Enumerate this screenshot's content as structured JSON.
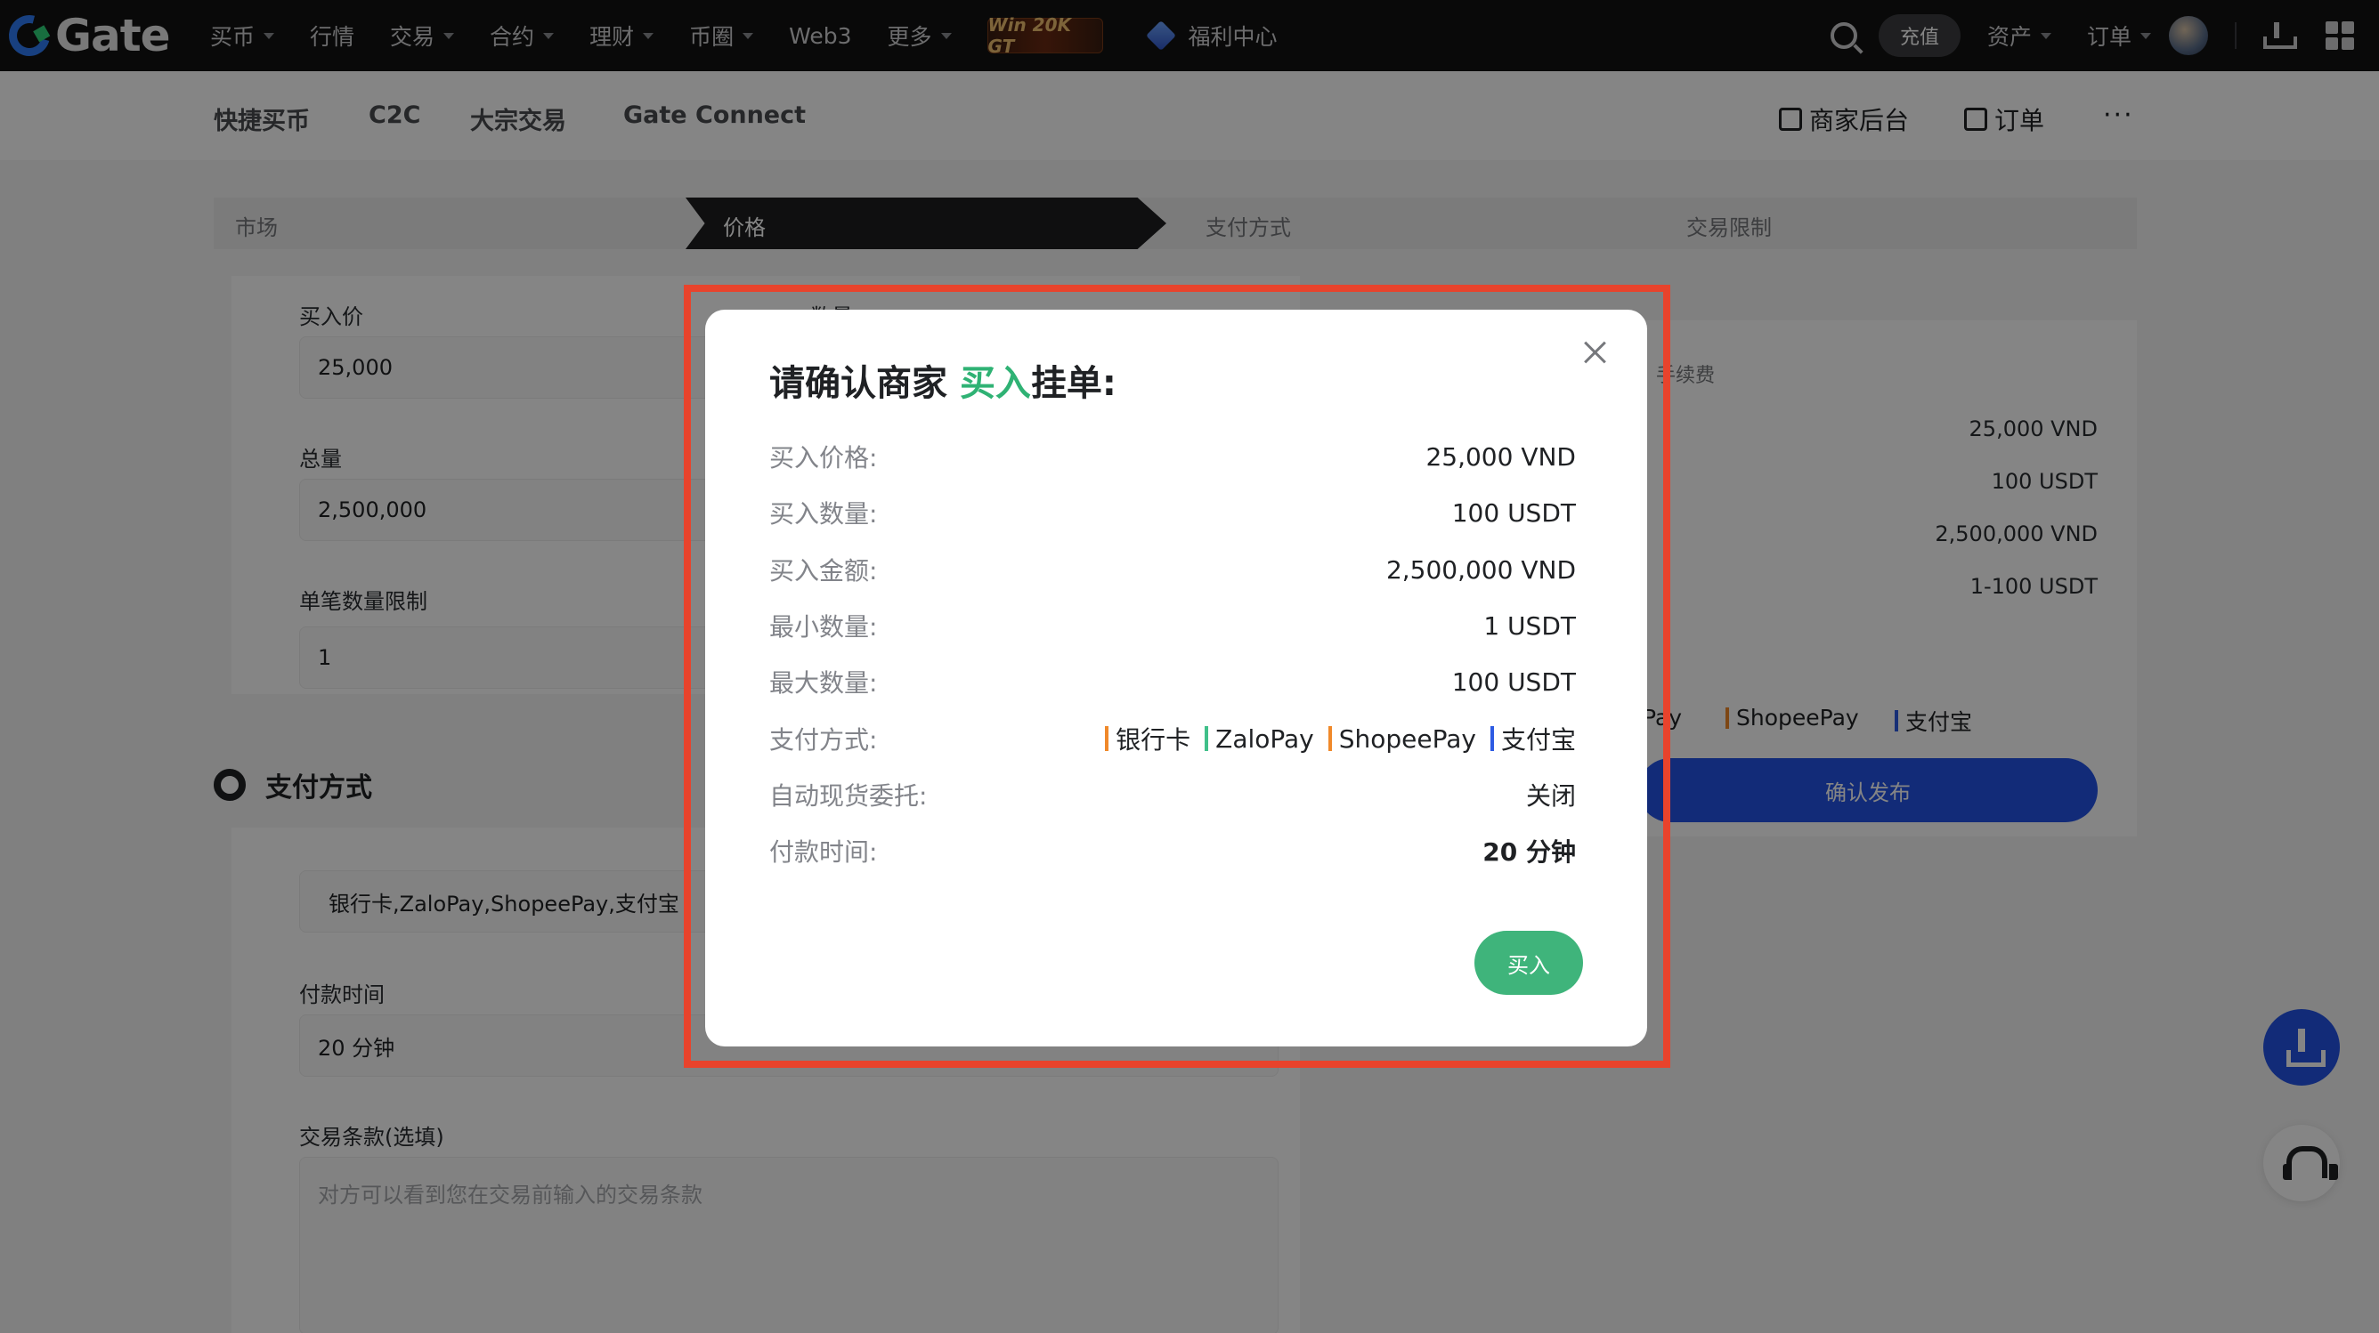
{
  "topnav": {
    "logo": "Gate",
    "items": [
      {
        "label": "买币",
        "caret": true
      },
      {
        "label": "行情",
        "caret": false
      },
      {
        "label": "交易",
        "caret": true
      },
      {
        "label": "合约",
        "caret": true
      },
      {
        "label": "理财",
        "caret": true
      },
      {
        "label": "币圈",
        "caret": true
      },
      {
        "label": "Web3",
        "caret": false
      },
      {
        "label": "更多",
        "caret": true
      }
    ],
    "promo": "Win 20K GT",
    "welfare": "福利中心",
    "deposit": "充值",
    "assets": "资产",
    "orders": "订单"
  },
  "subnav": {
    "items": [
      "快捷买币",
      "C2C",
      "大宗交易",
      "Gate Connect"
    ],
    "merchant_backend": "商家后台",
    "orders": "订单",
    "more": "···"
  },
  "stepper": {
    "steps": [
      "市场",
      "价格",
      "支付方式",
      "交易限制"
    ],
    "active": "价格"
  },
  "form": {
    "buy_price_label": "买入价",
    "buy_price_value": "25,000",
    "quantity_label": "数量",
    "total_label": "总量",
    "total_value": "2,500,000",
    "limit_label": "单笔数量限制",
    "limit_min_value": "1",
    "payment_section_title": "支付方式",
    "payment_methods_value": "银行卡,ZaloPay,ShopeePay,支付宝",
    "payment_time_label": "付款时间",
    "payment_time_value": "20 分钟",
    "terms_label": "交易条款(选填)",
    "terms_placeholder": "对方可以看到您在交易前输入的交易条款"
  },
  "summary": {
    "fee_label": "手续费",
    "price": "25,000 VND",
    "quantity": "100 USDT",
    "total": "2,500,000 VND",
    "limits": "1-100 USDT",
    "pay_partial": "Pay",
    "pay_shopee": "ShopeePay",
    "pay_alipay": "支付宝",
    "publish": "确认发布"
  },
  "modal": {
    "title_pre": "请确认商家 ",
    "title_action": "买入",
    "title_post": "挂单:",
    "rows": [
      {
        "label": "买入价格:",
        "value": "25,000 VND"
      },
      {
        "label": "买入数量:",
        "value": "100 USDT"
      },
      {
        "label": "买入金额:",
        "value": "2,500,000 VND"
      },
      {
        "label": "最小数量:",
        "value": "1 USDT"
      },
      {
        "label": "最大数量:",
        "value": "100 USDT"
      }
    ],
    "payment_label": "支付方式:",
    "payment_methods": [
      {
        "name": "银行卡",
        "color": "#f0892a"
      },
      {
        "name": "ZaloPay",
        "color": "#40c08a"
      },
      {
        "name": "ShopeePay",
        "color": "#f0892a"
      },
      {
        "name": "支付宝",
        "color": "#2d5be3"
      }
    ],
    "auto_spot_label": "自动现货委托:",
    "auto_spot_value": "关闭",
    "pay_time_label": "付款时间:",
    "pay_time_value": "20 分钟",
    "buy_button": "买入"
  },
  "colors": {
    "accent_green": "#3fb47b",
    "primary_blue": "#2354e6",
    "highlight_red": "#e8432c"
  }
}
